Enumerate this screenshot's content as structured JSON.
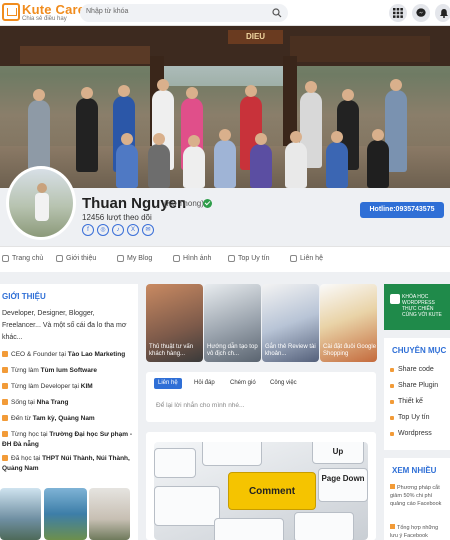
{
  "header": {
    "brand": "Kute Care",
    "slogan": "Chia sẻ điều hay",
    "search_placeholder": "Nhập từ khóa",
    "icons": [
      "grid-icon",
      "messenger-icon",
      "bell-icon"
    ]
  },
  "cover": {
    "sign": "DIEU"
  },
  "profile": {
    "name": "Thuan Nguyen",
    "nickname": "(Ku Thong)",
    "followers": "12456 lượt theo dõi",
    "social": [
      "f",
      "◎",
      "♪",
      "X",
      "✉"
    ],
    "hotline": "Hotline:0935743575"
  },
  "tabs": [
    "Trang chủ",
    "Giới thiệu",
    "My Blog",
    "Hình ảnh",
    "Top Uy tín",
    "Liên hệ"
  ],
  "intro": {
    "title": "GIỚI THIỆU",
    "text": "Developer, Designer, Blogger, Freelancer... Và một số cái đa lo tha mơ khác...",
    "items": [
      {
        "pre": "CEO & Founder tại ",
        "bold": "Tào Lao Marketing"
      },
      {
        "pre": "Từng làm ",
        "bold": "Tùm lum Software"
      },
      {
        "pre": "Từng làm Developer tại ",
        "bold": "KIM"
      },
      {
        "pre": "Sống tại ",
        "bold": "Nha Trang"
      },
      {
        "pre": "Đến từ ",
        "bold": "Tam kỳ, Quảng Nam"
      },
      {
        "pre": "Từng học tại ",
        "bold": "Trường Đại học Sư phạm - ĐH Đà nẵng"
      },
      {
        "pre": "Đã học tại ",
        "bold": "THPT Núi Thành, Núi Thành, Quảng Nam"
      }
    ]
  },
  "posts": [
    "Thủ thuật tư vấn khách hàng...",
    "Hướng dẫn tạo top vô địch ch...",
    "Gắn thẻ Review tài khoản...",
    "Cài đặt đuôi Google Shopping"
  ],
  "composer": {
    "tabs": [
      "Liên hệ",
      "Hỏi đáp",
      "Chém gió",
      "Công việc"
    ],
    "placeholder": "Để lại lời nhắn cho mình nhé..."
  },
  "feed": {
    "keys": [
      "Comment",
      "Up",
      "Page Down"
    ]
  },
  "ad": {
    "text": "KHÓA HỌC WORDPRESS THỰC CHIẾN CÙNG VỚI KUTE"
  },
  "categories": {
    "title": "CHUYÊN MỤC",
    "items": [
      "Share code",
      "Share Plugin",
      "Thiết kế",
      "Top Uy tín",
      "Wordpress"
    ]
  },
  "popular": {
    "title": "XEM NHIỀU",
    "items": [
      "Phương pháp cắt giảm 50% chi phí quảng cáo Facebook",
      "Tổng hợp những lưu ý Facebook"
    ]
  }
}
